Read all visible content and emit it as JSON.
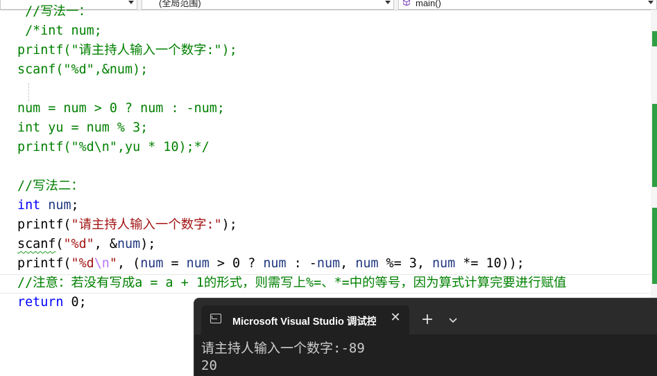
{
  "navbar": {
    "scope_dropdown": "(全局范围)",
    "function_dropdown": "main()"
  },
  "code": {
    "lines": [
      {
        "segments": [
          {
            "cls": "c-comment",
            "text": " //写法一："
          }
        ]
      },
      {
        "segments": [
          {
            "cls": "c-comment",
            "text": " /*int num;"
          }
        ]
      },
      {
        "segments": [
          {
            "cls": "c-comment",
            "text": "printf(\"请主持人输入一个数字:\");"
          }
        ]
      },
      {
        "segments": [
          {
            "cls": "c-comment",
            "text": "scanf(\"%d\",&num);"
          }
        ]
      },
      {
        "segments": [
          {
            "cls": "c-comment",
            "text": ""
          }
        ]
      },
      {
        "segments": [
          {
            "cls": "c-comment",
            "text": "num = num > 0 ? num : -num;"
          }
        ]
      },
      {
        "segments": [
          {
            "cls": "c-comment",
            "text": "int yu = num % 3;"
          }
        ]
      },
      {
        "segments": [
          {
            "cls": "c-comment",
            "text": "printf(\"%d\\n\",yu * 10);*/"
          }
        ]
      },
      {
        "segments": [
          {
            "cls": "c-comment",
            "text": ""
          }
        ]
      },
      {
        "segments": [
          {
            "cls": "c-comment",
            "text": "//写法二："
          }
        ]
      },
      {
        "segments": [
          {
            "cls": "c-kw",
            "text": "int"
          },
          {
            "cls": "c-plain",
            "text": " "
          },
          {
            "cls": "c-var",
            "text": "num"
          },
          {
            "cls": "c-plain",
            "text": ";"
          }
        ]
      },
      {
        "segments": [
          {
            "cls": "c-plain",
            "text": "printf("
          },
          {
            "cls": "c-str",
            "text": "\"请主持人输入一个数字:\""
          },
          {
            "cls": "c-plain",
            "text": ");"
          }
        ]
      },
      {
        "segments": [
          {
            "cls": "c-plain squiggle",
            "text": "scanf"
          },
          {
            "cls": "c-plain",
            "text": "("
          },
          {
            "cls": "c-str",
            "text": "\"%d\""
          },
          {
            "cls": "c-plain",
            "text": ", &"
          },
          {
            "cls": "c-var",
            "text": "num"
          },
          {
            "cls": "c-plain",
            "text": ");"
          }
        ]
      },
      {
        "segments": [
          {
            "cls": "c-plain",
            "text": "printf("
          },
          {
            "cls": "c-str",
            "text": "\"%d"
          },
          {
            "cls": "c-esc",
            "text": "\\n"
          },
          {
            "cls": "c-str",
            "text": "\""
          },
          {
            "cls": "c-plain",
            "text": ", ("
          },
          {
            "cls": "c-var",
            "text": "num"
          },
          {
            "cls": "c-plain",
            "text": " = "
          },
          {
            "cls": "c-var",
            "text": "num"
          },
          {
            "cls": "c-plain",
            "text": " > 0 ? "
          },
          {
            "cls": "c-var",
            "text": "num"
          },
          {
            "cls": "c-plain",
            "text": " : -"
          },
          {
            "cls": "c-var",
            "text": "num"
          },
          {
            "cls": "c-plain",
            "text": ", "
          },
          {
            "cls": "c-var",
            "text": "num"
          },
          {
            "cls": "c-plain",
            "text": " %= 3, "
          },
          {
            "cls": "c-var",
            "text": "num"
          },
          {
            "cls": "c-plain",
            "text": " *= 10));"
          }
        ]
      },
      {
        "segments": [
          {
            "cls": "c-comment",
            "text": "//注意：若没有写成a = a + 1的形式，则需写上%=、*=中的等号，因为算式计算完要进行赋值"
          }
        ]
      },
      {
        "segments": [
          {
            "cls": "c-kw",
            "text": "return"
          },
          {
            "cls": "c-plain",
            "text": " 0;"
          }
        ]
      }
    ]
  },
  "terminal": {
    "tab_title": "Microsoft Visual Studio 调试控制台",
    "close_glyph": "✕",
    "new_tab_glyph": "+",
    "output": [
      "请主持人输入一个数字:-89",
      "20"
    ]
  },
  "colors": {
    "comment": "#008000",
    "keyword": "#0000ff",
    "string": "#a31515",
    "escape": "#b776fb",
    "variable": "#1f377f",
    "terminal_bg": "#202020"
  }
}
